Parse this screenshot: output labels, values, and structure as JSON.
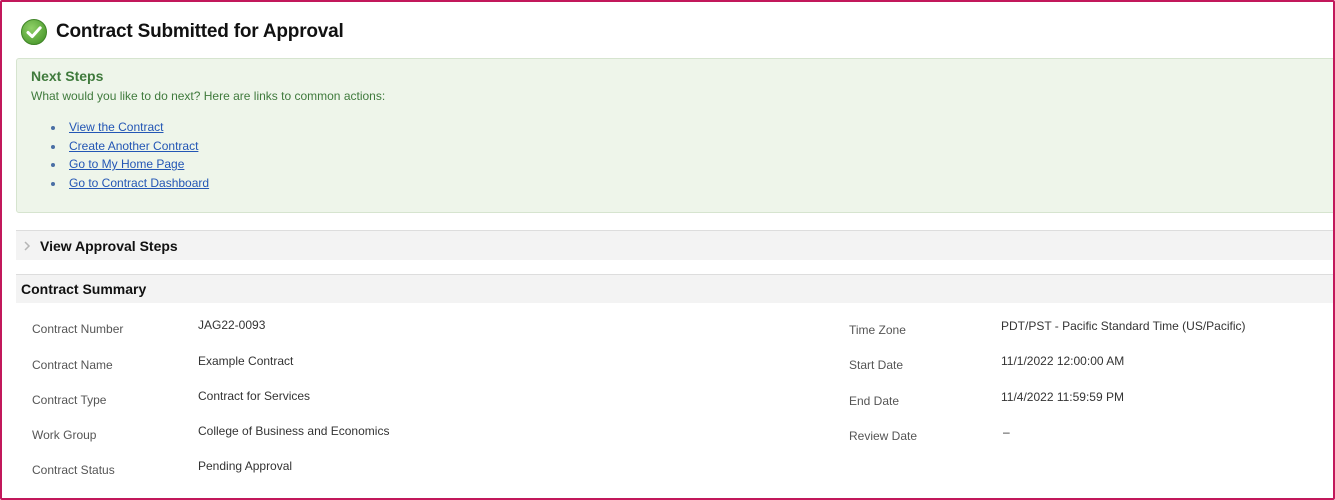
{
  "header": {
    "title": "Contract Submitted for Approval",
    "icon": "check-circle-icon",
    "icon_color": "#5aa83a"
  },
  "next_steps": {
    "title": "Next Steps",
    "description": "What would you like to do next? Here are links to common actions:",
    "links": [
      "View the Contract",
      "Create Another Contract",
      "Go to My Home Page",
      "Go to Contract Dashboard"
    ]
  },
  "approval_steps": {
    "label": "View Approval Steps"
  },
  "contract_summary": {
    "title": "Contract Summary",
    "left_fields": [
      {
        "label": "Contract Number",
        "value": "JAG22-0093"
      },
      {
        "label": "Contract Name",
        "value": "Example Contract"
      },
      {
        "label": "Contract Type",
        "value": "Contract for Services"
      },
      {
        "label": "Work Group",
        "value": "College of Business and Economics"
      },
      {
        "label": "Contract Status",
        "value": "Pending Approval"
      }
    ],
    "right_fields": [
      {
        "label": "Time Zone",
        "value": "PDT/PST - Pacific Standard Time (US/Pacific)"
      },
      {
        "label": "Start Date",
        "value": "11/1/2022 12:00:00 AM"
      },
      {
        "label": "End Date",
        "value": "11/4/2022 11:59:59 PM"
      },
      {
        "label": "Review Date",
        "value": "–"
      }
    ]
  },
  "colors": {
    "frame_border": "#c2185b",
    "next_steps_bg": "#eef5ea",
    "next_steps_text": "#3f7a3c",
    "link": "#2356b5",
    "section_bar_bg": "#f3f3f3"
  }
}
